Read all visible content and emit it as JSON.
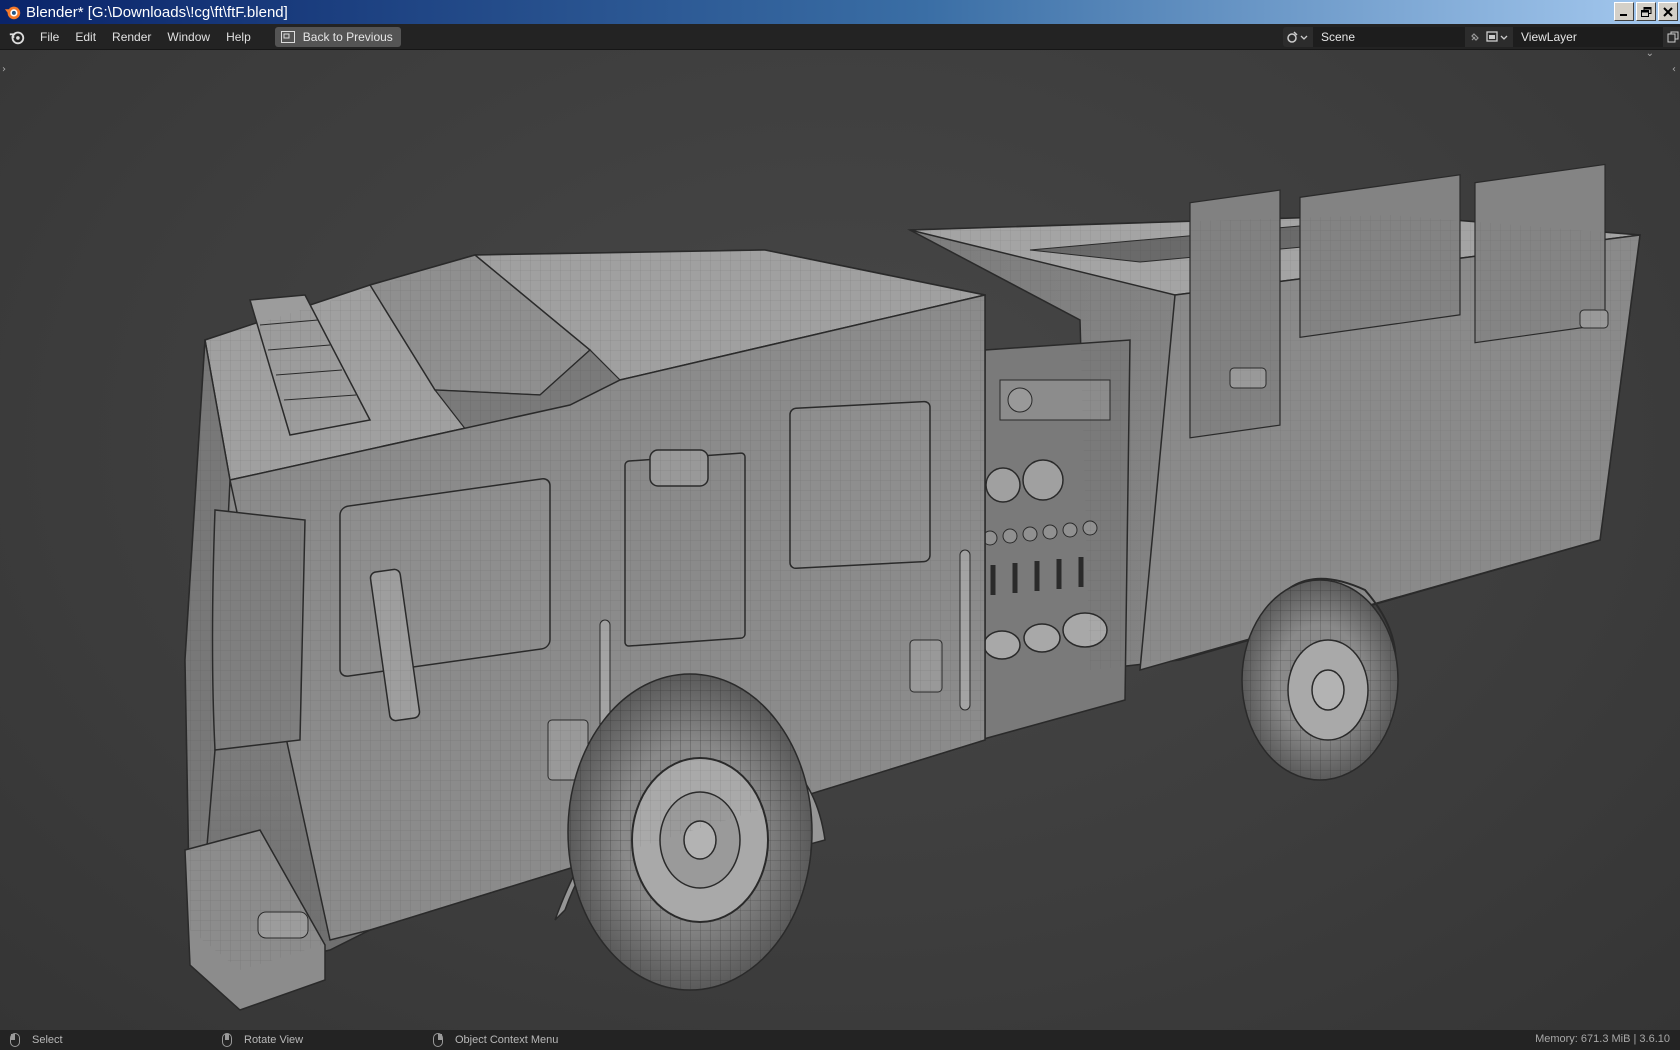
{
  "window": {
    "title": "Blender* [G:\\Downloads\\!cg\\ft\\ftF.blend]"
  },
  "menu": {
    "items": [
      "File",
      "Edit",
      "Render",
      "Window",
      "Help"
    ],
    "back_button": "Back to Previous"
  },
  "scene": {
    "name": "Scene",
    "view_layer": "ViewLayer"
  },
  "statusbar": {
    "left_click": "Select",
    "middle_click": "Rotate View",
    "right_click": "Object Context Menu",
    "info": "Memory: 671.3 MiB | 3.6.10"
  },
  "colors": {
    "viewport_bg": "#3d3d3d",
    "topbar_bg": "#232323",
    "title_gradient_start": "#0a246a",
    "title_gradient_end": "#a6caf0"
  }
}
